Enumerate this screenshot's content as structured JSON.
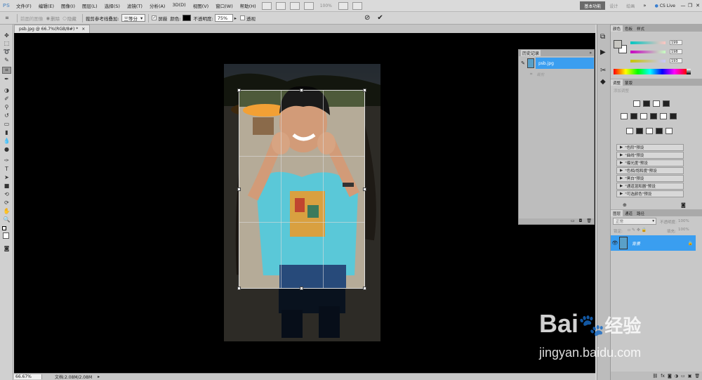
{
  "app": {
    "logo": "PS",
    "menus": [
      "文件(F)",
      "编辑(E)",
      "图像(I)",
      "图层(L)",
      "选择(S)",
      "滤镜(T)",
      "分析(A)",
      "3D(D)",
      "视图(V)",
      "窗口(W)",
      "帮助(H)"
    ],
    "zoom_display": "100%",
    "workspace_buttons": [
      "基本功能",
      "设计",
      "绘画"
    ],
    "cslive": "CS Live"
  },
  "options": {
    "front_image": "前面的图像",
    "delete_label": "删除",
    "hide_label": "隐藏",
    "overlay_label": "裁剪参考线叠加:",
    "overlay_value": "三等分",
    "shield_label": "屏蔽",
    "color_label": "颜色:",
    "opacity_label": "不透明度:",
    "opacity_value": "75%",
    "perspective_label": "透视",
    "colors": {
      "shield": "#000000"
    }
  },
  "document": {
    "tab_title": "psb.jpg @ 66.7%(RGB/8#) *",
    "status_zoom": "66.67%",
    "status_doc": "文档:2.08M/2.08M"
  },
  "history": {
    "title": "历史记录",
    "snapshot_name": "psb.jpg",
    "step": "裁剪"
  },
  "color_panel": {
    "tabs": [
      "颜色",
      "色板",
      "样式"
    ],
    "r": "199",
    "g": "198",
    "b": "193",
    "colors": {
      "foreground": "#c7c6c1"
    }
  },
  "adjustments": {
    "tabs": [
      "调整",
      "蒙版"
    ],
    "title": "添加调整",
    "presets": [
      "\"色阶\"预设",
      "\"曲线\"预设",
      "\"曝光度\"预设",
      "\"色相/饱和度\"预设",
      "\"黑白\"预设",
      "\"通道混和器\"预设",
      "\"可选颜色\"预设"
    ]
  },
  "layers": {
    "tabs": [
      "图层",
      "通道",
      "路径"
    ],
    "blend_mode": "正常",
    "opacity_label": "不透明度:",
    "opacity_value": "100%",
    "lock_label": "锁定:",
    "fill_label": "填充:",
    "fill_value": "100%",
    "layer_name": "背景",
    "colors": {
      "selected": "#3a9ef0"
    }
  },
  "watermark": {
    "brand": "Bai",
    "brand_cn": "经验",
    "url": "jingyan.baidu.com"
  }
}
